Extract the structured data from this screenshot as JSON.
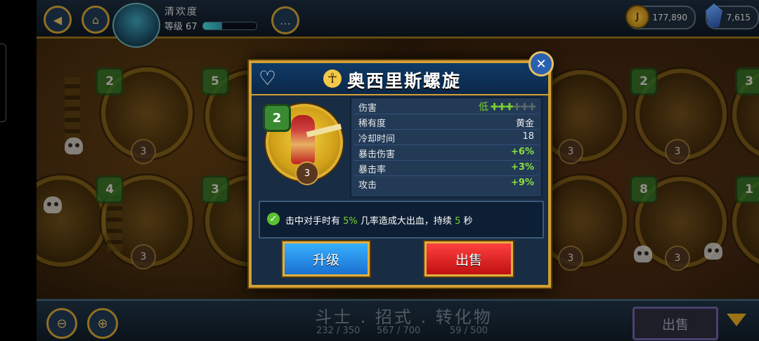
{
  "topbar": {
    "player_name": "清欢度",
    "level_label": "等级 67",
    "xp_progress": 0.35,
    "coins": "177,890",
    "coin_glyph": "J",
    "gems": "7,615"
  },
  "modal": {
    "title": "奥西里斯螺旋",
    "ankh_glyph": "☥",
    "move_hex_level": "2",
    "move_upgrade_level": "3",
    "stats": [
      {
        "label": "伤害",
        "value": "低",
        "pluses_on": 3,
        "pluses_total": 6
      },
      {
        "label": "稀有度",
        "value": "黄金"
      },
      {
        "label": "冷却时间",
        "value": "18"
      },
      {
        "label": "暴击伤害",
        "value": "+6%"
      },
      {
        "label": "暴击率",
        "value": "+3%"
      },
      {
        "label": "攻击",
        "value": "+9%"
      }
    ],
    "effect": {
      "prefix": "击中对手时有",
      "chance": "5%",
      "middle": "几率造成大出血，持续",
      "duration": "5",
      "suffix": "秒"
    },
    "upgrade_label": "升级",
    "sell_label": "出售",
    "close_glyph": "✕",
    "heart_glyph": "♡"
  },
  "bottombar": {
    "tabs_label": "斗士 . 招式 . 转化物",
    "counts": [
      "232 / 350",
      "567 / 700",
      "59 / 500"
    ],
    "sell_label": "出售"
  },
  "background_moves": {
    "hex_levels": [
      "2",
      "5",
      "4",
      "3",
      "2",
      "3",
      "8",
      "1"
    ],
    "slot_levels": [
      "3",
      "3",
      "3",
      "3",
      "3",
      "3",
      "3",
      "3"
    ]
  }
}
